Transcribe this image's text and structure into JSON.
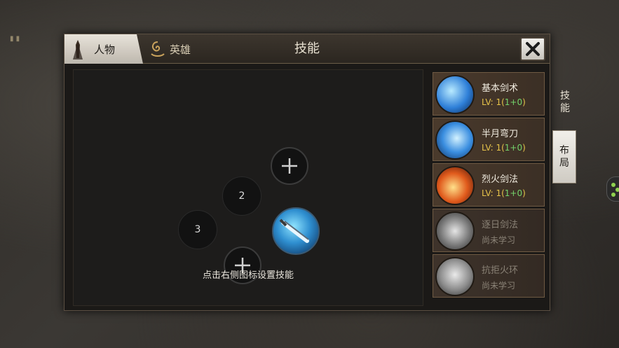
{
  "header": {
    "tab_person": "人物",
    "tab_hero": "英雄",
    "title": "技能"
  },
  "layout": {
    "slot_2": "2",
    "slot_3": "3",
    "hint": "点击右侧图标设置技能"
  },
  "skills": [
    {
      "name": "基本剑术",
      "lv_main": "LV: 1(",
      "lv_bonus": "1+0",
      "lv_close": ")",
      "icon": "sword-strike-icon"
    },
    {
      "name": "半月弯刀",
      "lv_main": "LV: 1(",
      "lv_bonus": "1+0",
      "lv_close": ")",
      "icon": "crescent-blade-icon"
    },
    {
      "name": "烈火剑法",
      "lv_main": "LV: 1(",
      "lv_bonus": "1+0",
      "lv_close": ")",
      "icon": "fire-sword-icon"
    },
    {
      "name": "逐日剑法",
      "status": "尚未学习",
      "icon": "sun-chase-sword-icon"
    },
    {
      "name": "抗拒火环",
      "status": "尚未学习",
      "icon": "repel-ring-icon"
    }
  ],
  "side_tabs": {
    "skills": [
      "技",
      "能"
    ],
    "layout": [
      "布",
      "局"
    ]
  },
  "colors": {
    "accent_gold": "#e6c34a",
    "bonus_green": "#74d36b",
    "locked_text": "#8a8276"
  }
}
